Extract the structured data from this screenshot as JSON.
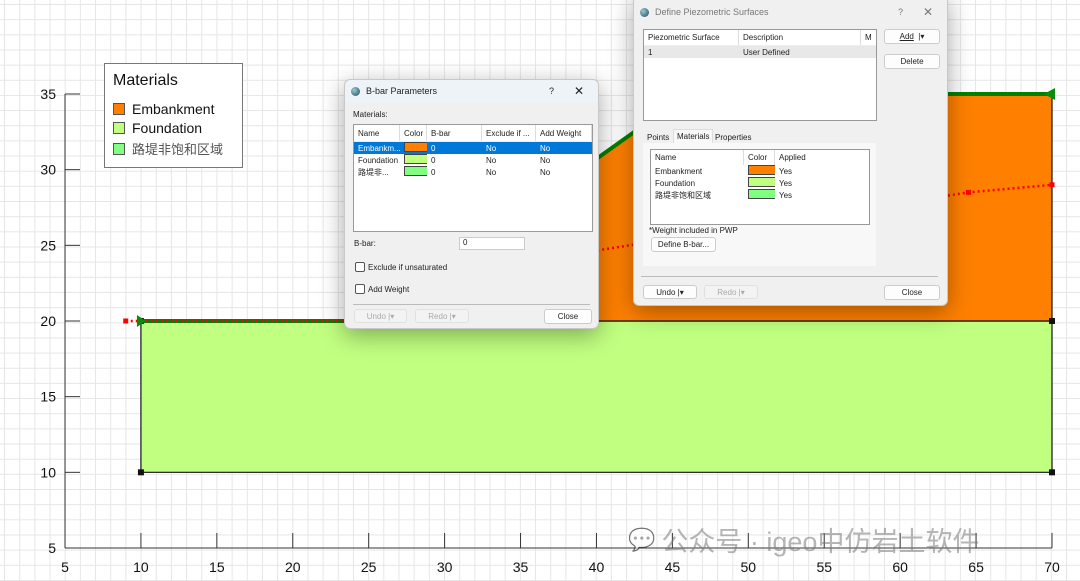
{
  "chart_data": {
    "type": "area",
    "xlim": [
      5,
      70
    ],
    "ylim": [
      5,
      35
    ],
    "x_ticks": [
      5,
      10,
      15,
      20,
      25,
      30,
      35,
      40,
      45,
      50,
      55,
      60,
      65,
      70
    ],
    "y_ticks": [
      5,
      10,
      15,
      20,
      25,
      30,
      35
    ],
    "regions": [
      {
        "name": "Foundation",
        "color": "#c0ff80",
        "points": [
          [
            10,
            10
          ],
          [
            70,
            10
          ],
          [
            70,
            20
          ],
          [
            10,
            20
          ]
        ]
      },
      {
        "name": "Embankment",
        "color": "#ff8000",
        "points": [
          [
            25,
            20
          ],
          [
            46,
            35
          ],
          [
            70,
            35
          ],
          [
            70,
            20
          ]
        ]
      }
    ],
    "ground_surface": {
      "color": "#008000",
      "points": [
        [
          10,
          20
        ],
        [
          25,
          20
        ],
        [
          46,
          35
        ],
        [
          70,
          35
        ]
      ]
    },
    "water_table": {
      "color": "#ff0000",
      "points": [
        [
          9,
          20
        ],
        [
          28,
          20
        ],
        [
          39,
          24.5
        ],
        [
          64.5,
          28.5
        ],
        [
          70,
          29
        ]
      ]
    },
    "vertices": [
      [
        10,
        10
      ],
      [
        70,
        10
      ],
      [
        70,
        20
      ],
      [
        10,
        20
      ],
      [
        70,
        35
      ]
    ]
  },
  "legend": {
    "title": "Materials",
    "items": [
      {
        "label": "Embankment",
        "color": "#ff8000"
      },
      {
        "label": "Foundation",
        "color": "#c0ff80"
      },
      {
        "label": "路堤非饱和区域",
        "color": "#80ff80"
      }
    ]
  },
  "bbar": {
    "title": "B-bar Parameters",
    "help": "?",
    "close_x": "✕",
    "materials_label": "Materials:",
    "columns": [
      "Name",
      "Color",
      "B-bar",
      "Exclude if ...",
      "Add Weight"
    ],
    "rows": [
      {
        "name": "Embankm...",
        "color": "#ff8000",
        "bbar": "0",
        "exclude": "No",
        "weight": "No",
        "selected": true
      },
      {
        "name": "Foundation",
        "color": "#c0ff80",
        "bbar": "0",
        "exclude": "No",
        "weight": "No"
      },
      {
        "name": "路堤非...",
        "color": "#80ff80",
        "bbar": "0",
        "exclude": "No",
        "weight": "No"
      }
    ],
    "bbar_label": "B-bar:",
    "bbar_value": "0",
    "exclude_label": "Exclude if unsaturated",
    "weight_label": "Add Weight",
    "undo": "Undo",
    "redo": "Redo",
    "close": "Close"
  },
  "piezo": {
    "title": "Define Piezometric Surfaces",
    "help": "?",
    "close_x": "✕",
    "columns": [
      "Piezometric Surface",
      "Description",
      "M"
    ],
    "rows": [
      {
        "id": "1",
        "desc": "User Defined"
      }
    ],
    "add": "Add",
    "delete": "Delete",
    "tabs": [
      "Points",
      "Materials",
      "Properties"
    ],
    "mat_columns": [
      "Name",
      "Color",
      "Applied"
    ],
    "materials": [
      {
        "name": "Embankment",
        "color": "#ff8000",
        "applied": "Yes"
      },
      {
        "name": "Foundation",
        "color": "#c0ff80",
        "applied": "Yes"
      },
      {
        "name": "路堤非饱和区域",
        "color": "#80ff80",
        "applied": "Yes"
      }
    ],
    "note": "*Weight included in PWP",
    "define_bbar": "Define B-bar...",
    "undo": "Undo",
    "redo": "Redo",
    "close": "Close"
  },
  "watermark": "公众号 · igeo中仿岩土软件"
}
